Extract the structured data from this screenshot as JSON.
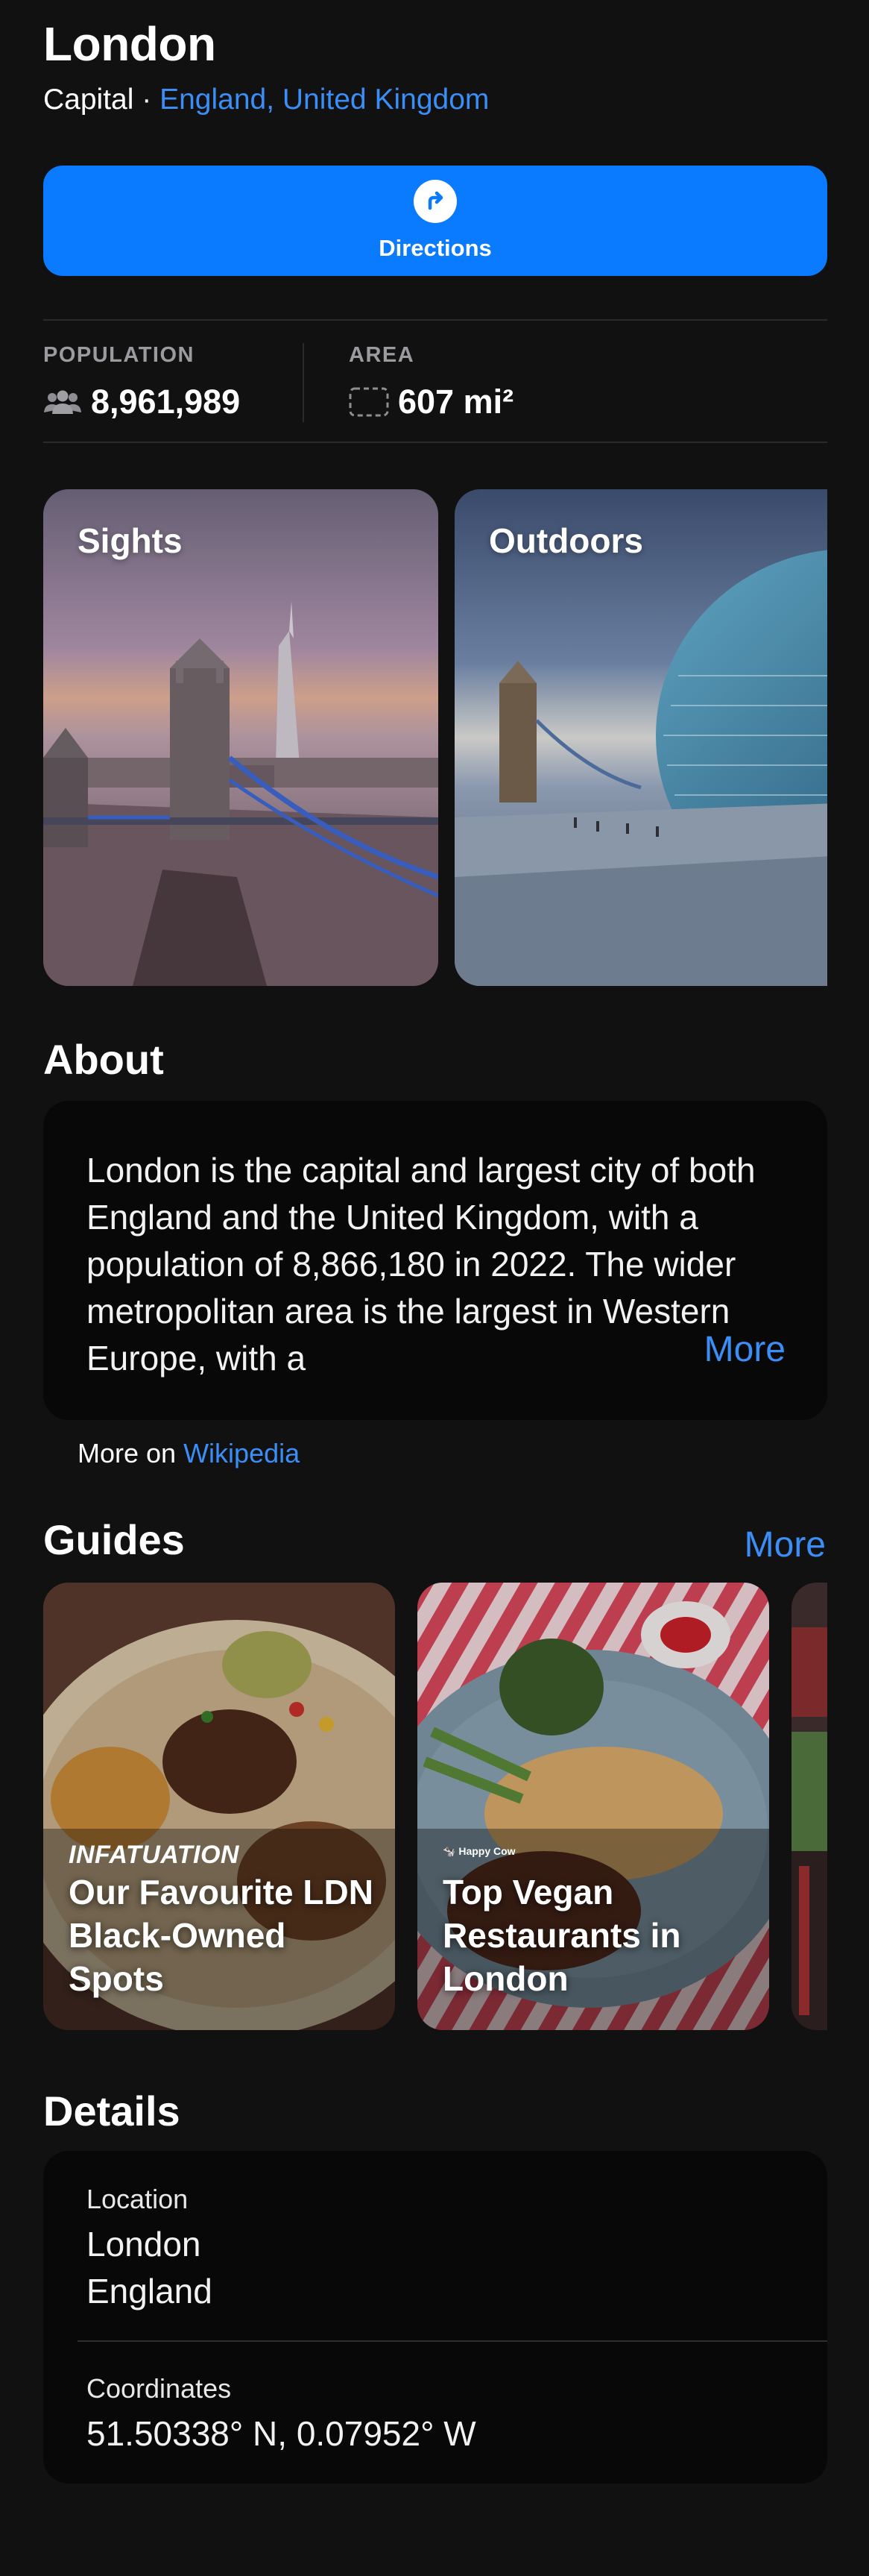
{
  "place": {
    "name": "London",
    "type": "Capital",
    "separator": " · ",
    "region_link": "England, United Kingdom"
  },
  "actions": {
    "directions_label": "Directions",
    "directions_icon": "turn-right-arrow-icon"
  },
  "stats": {
    "population": {
      "label": "POPULATION",
      "value": "8,961,989",
      "icon": "people-icon"
    },
    "area": {
      "label": "AREA",
      "value": "607 mi²",
      "icon": "dashed-square-icon"
    }
  },
  "categories": [
    {
      "label": "Sights"
    },
    {
      "label": "Outdoors"
    }
  ],
  "about": {
    "heading": "About",
    "text": "London is the capital and largest city of both England and the United Kingdom, with a population of 8,866,180 in 2022. The wider metropolitan area is the largest in Western Europe, with a",
    "more_label": "More",
    "source_prefix": "More on ",
    "source_link": "Wikipedia"
  },
  "guides": {
    "heading": "Guides",
    "more_label": "More",
    "items": [
      {
        "brand": "INFATUATION",
        "title": "Our Favourite LDN Black-Owned Spots"
      },
      {
        "brand": "Happy Cow",
        "title": "Top Vegan Restaurants in London"
      },
      {
        "brand": "",
        "title": ""
      }
    ]
  },
  "details": {
    "heading": "Details",
    "location_label": "Location",
    "location_line1": "London",
    "location_line2": "England",
    "coordinates_label": "Coordinates",
    "coordinates_value": "51.50338° N, 0.07952° W"
  },
  "colors": {
    "background": "#111112",
    "accent": "#0a7aff",
    "link": "#3a8ef6",
    "card": "#080809"
  }
}
